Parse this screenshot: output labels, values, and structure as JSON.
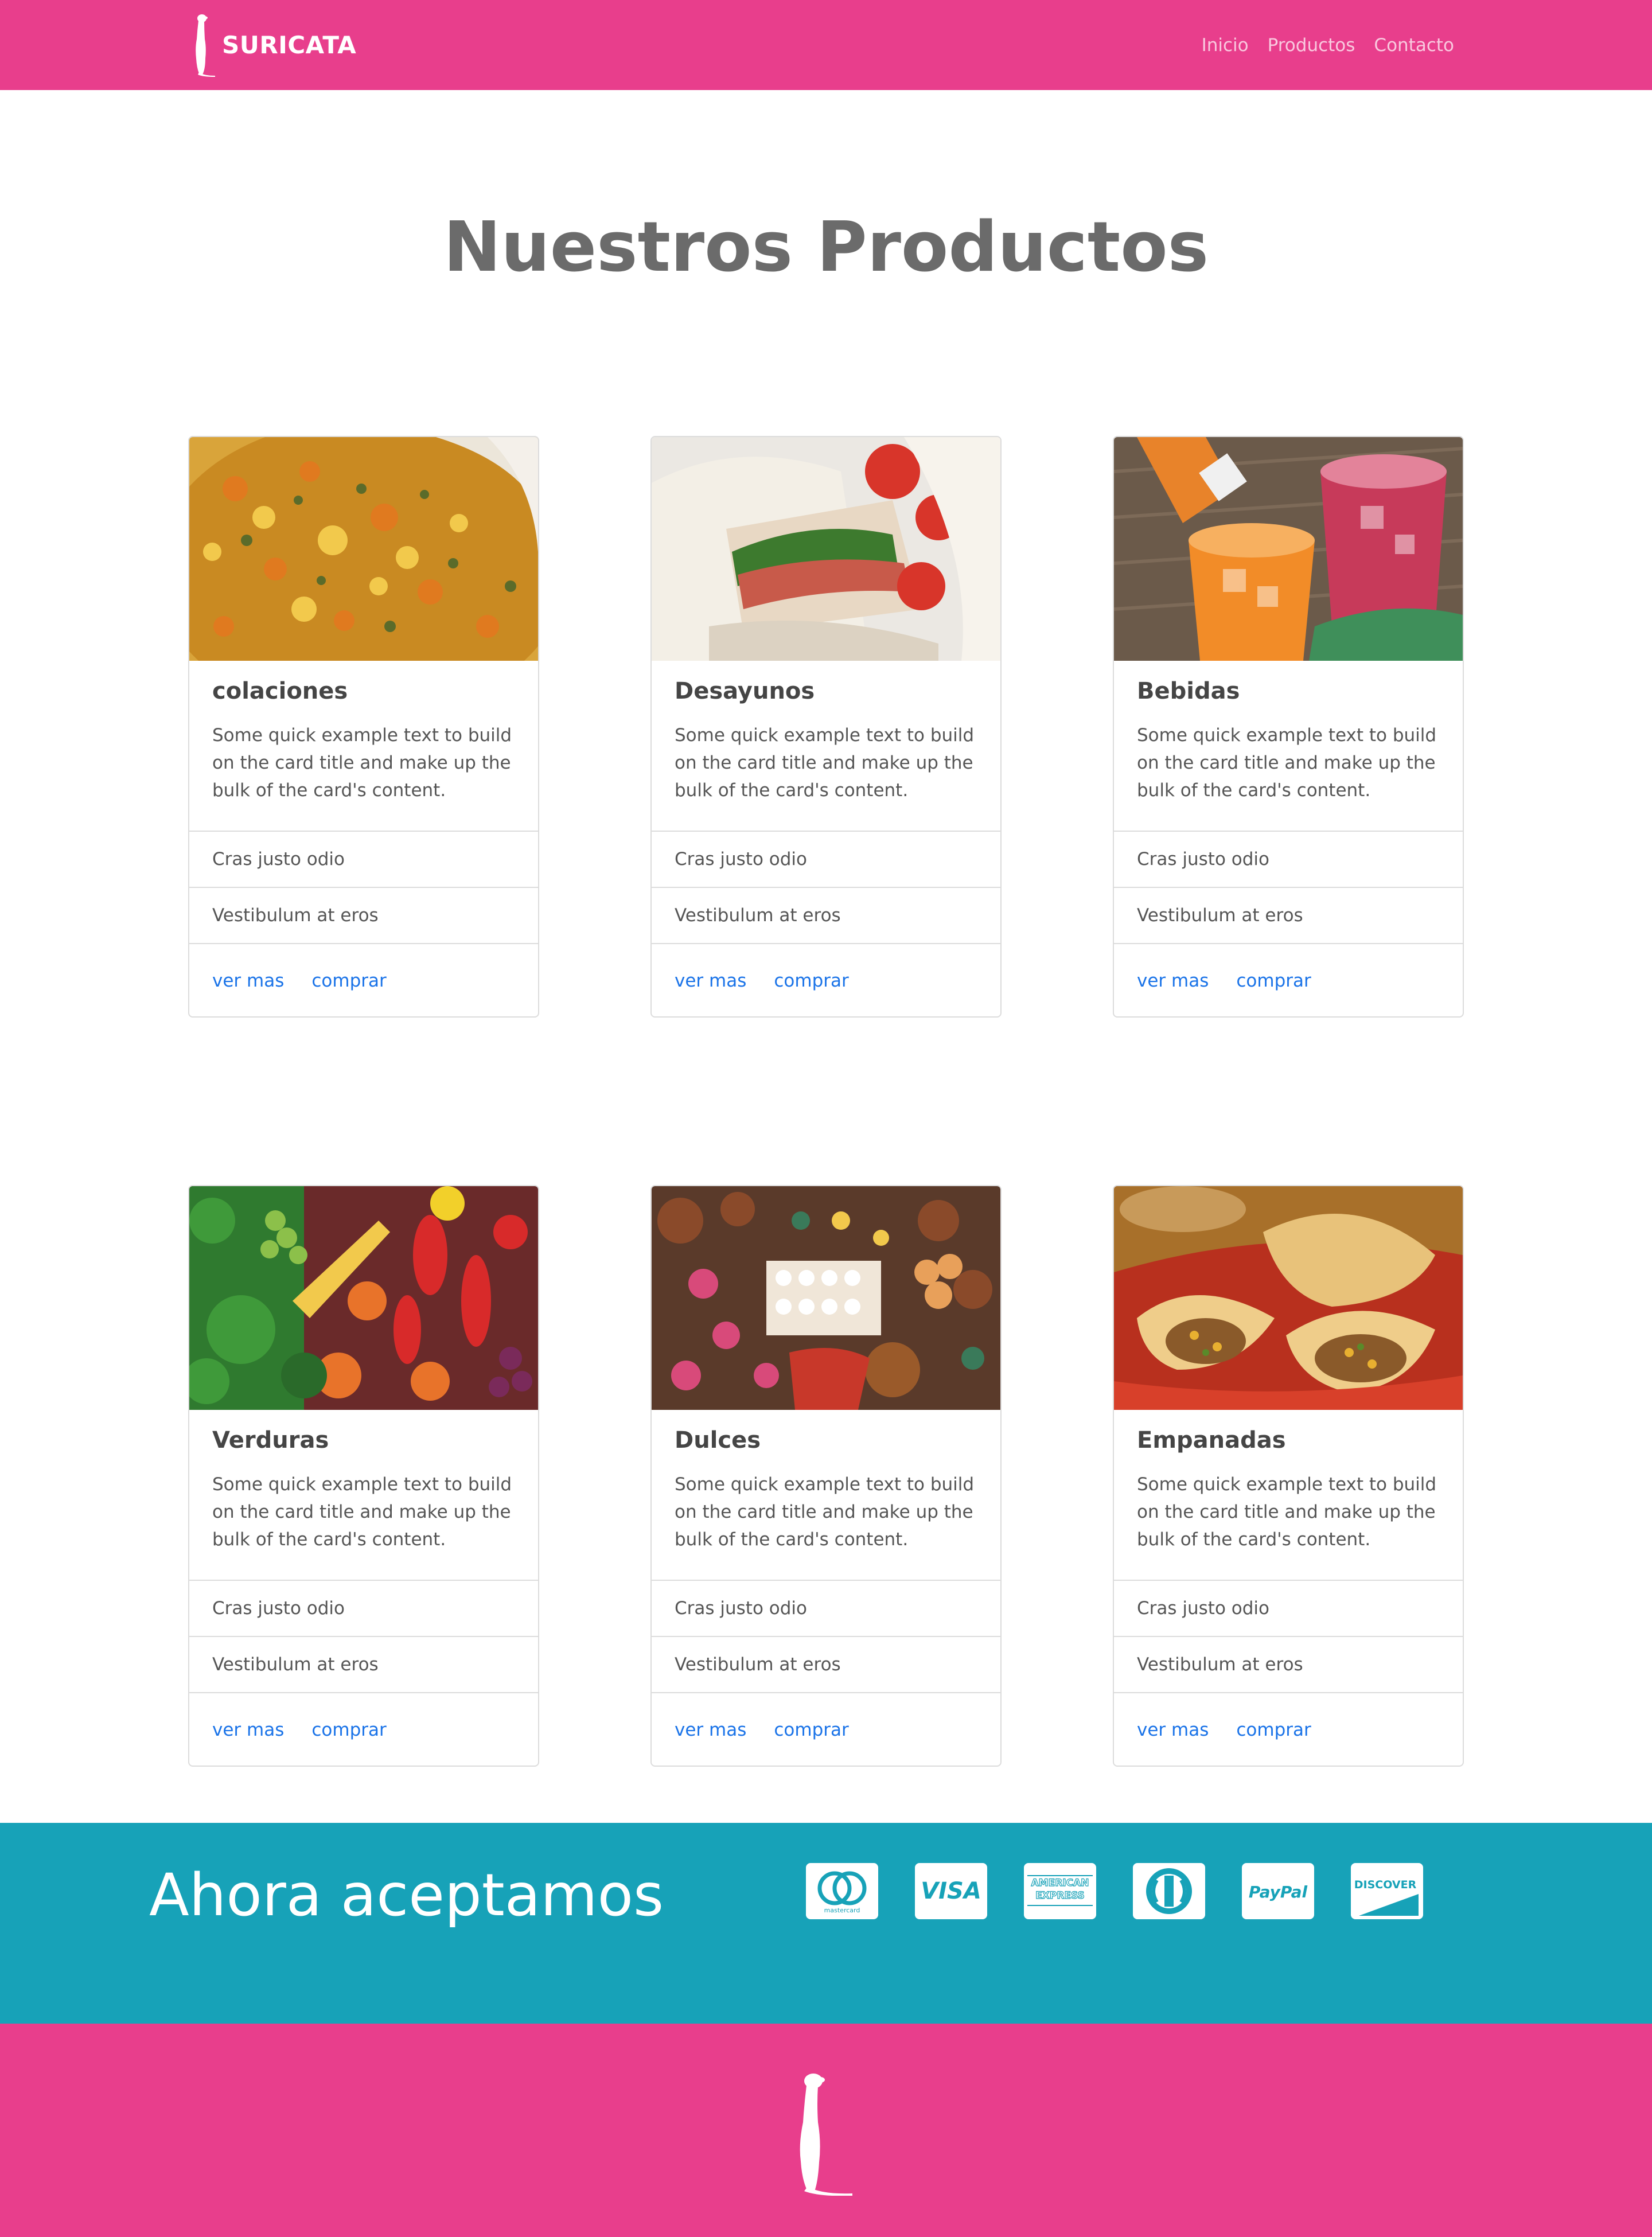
{
  "navbar": {
    "brand": "SURICATA",
    "logo_icon": "meerkat-icon",
    "links": [
      "Inicio",
      "Productos",
      "Contacto"
    ],
    "bg_color": "#e83e8c"
  },
  "page": {
    "title": "Nuestros Productos"
  },
  "cards": [
    {
      "title": "colaciones",
      "text": "Some quick example text to build on the card title and make up the bulk of the card's content.",
      "list": [
        "Cras justo odio",
        "Vestibulum at eros"
      ],
      "link1": "ver mas",
      "link2": "comprar",
      "image": "vegetable-stew-photo"
    },
    {
      "title": "Desayunos",
      "text": "Some quick example text to build on the card title and make up the bulk of the card's content.",
      "list": [
        "Cras justo odio",
        "Vestibulum at eros"
      ],
      "link1": "ver mas",
      "link2": "comprar",
      "image": "sandwich-photo"
    },
    {
      "title": "Bebidas",
      "text": "Some quick example text to build on the card title and make up the bulk of the card's content.",
      "list": [
        "Cras justo odio",
        "Vestibulum at eros"
      ],
      "link1": "ver mas",
      "link2": "comprar",
      "image": "drinks-photo"
    },
    {
      "title": "Verduras",
      "text": "Some quick example text to build on the card title and make up the bulk of the card's content.",
      "list": [
        "Cras justo odio",
        "Vestibulum at eros"
      ],
      "link1": "ver mas",
      "link2": "comprar",
      "image": "vegetables-photo"
    },
    {
      "title": "Dulces",
      "text": "Some quick example text to build on the card title and make up the bulk of the card's content.",
      "list": [
        "Cras justo odio",
        "Vestibulum at eros"
      ],
      "link1": "ver mas",
      "link2": "comprar",
      "image": "sweets-photo"
    },
    {
      "title": "Empanadas",
      "text": "Some quick example text to build on the card title and make up the bulk of the card's content.",
      "list": [
        "Cras justo odio",
        "Vestibulum at eros"
      ],
      "link1": "ver mas",
      "link2": "comprar",
      "image": "empanadas-photo"
    }
  ],
  "payments": {
    "title": "Ahora aceptamos",
    "bg_color": "#17a2b8",
    "icons": [
      "mastercard-icon",
      "visa-icon",
      "american-express-icon",
      "diners-club-icon",
      "paypal-icon",
      "discover-icon"
    ],
    "labels": {
      "mastercard": "mastercard",
      "visa": "VISA",
      "amex_line1": "AMERICAN",
      "amex_line2": "EXPRESS",
      "paypal": "PayPal",
      "discover": "DISCOVER"
    }
  },
  "footer": {
    "logo_icon": "meerkat-icon",
    "bg_color": "#e83e8c"
  }
}
